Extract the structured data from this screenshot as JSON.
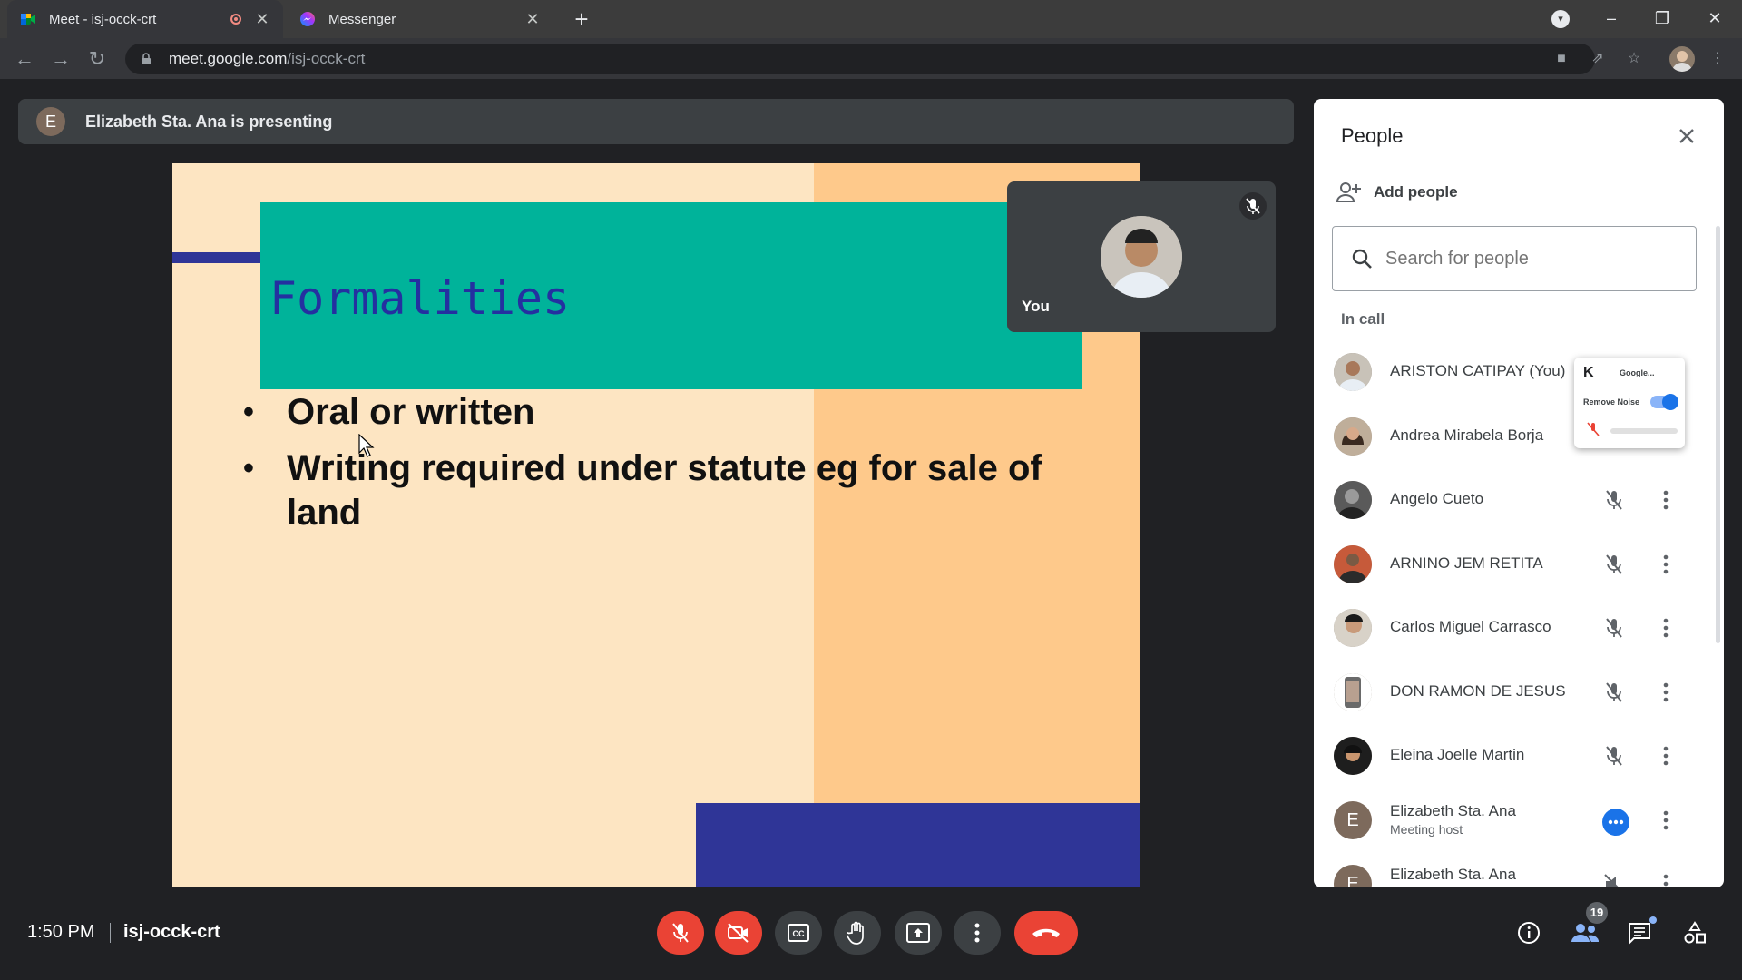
{
  "browser": {
    "tabs": [
      {
        "title": "Meet - isj-occk-crt",
        "active": true
      },
      {
        "title": "Messenger",
        "active": false
      }
    ],
    "url_host": "meet.google.com",
    "url_path": "/isj-occk-crt"
  },
  "meet": {
    "presenting_banner": "Elizabeth Sta. Ana is presenting",
    "presenter_initial": "E",
    "self_tile_label": "You",
    "slide": {
      "title": "Formalities",
      "bullets": [
        "Oral or written",
        "Writing required under statute eg for sale of land"
      ]
    },
    "time": "1:50 PM",
    "meeting_code": "isj-occk-crt",
    "participant_count": "19"
  },
  "people_panel": {
    "title": "People",
    "add_people": "Add people",
    "search_placeholder": "Search for people",
    "section": "In call",
    "participants": [
      {
        "name": "ARISTON CATIPAY (You)",
        "subtitle": "",
        "avatar": "photo"
      },
      {
        "name": "Andrea Mirabela Borja",
        "subtitle": "",
        "avatar": "photo"
      },
      {
        "name": "Angelo Cueto",
        "subtitle": "",
        "avatar": "photo"
      },
      {
        "name": "ARNINO JEM RETITA",
        "subtitle": "",
        "avatar": "photo"
      },
      {
        "name": "Carlos Miguel Carrasco",
        "subtitle": "",
        "avatar": "photo"
      },
      {
        "name": "DON RAMON DE JESUS",
        "subtitle": "",
        "avatar": "photo"
      },
      {
        "name": "Eleina Joelle Martin",
        "subtitle": "",
        "avatar": "photo"
      },
      {
        "name": "Elizabeth Sta. Ana",
        "subtitle": "Meeting host",
        "avatar": "E"
      },
      {
        "name": "Elizabeth Sta. Ana",
        "subtitle": "",
        "avatar": "E"
      }
    ]
  },
  "extension_popup": {
    "logo": "K",
    "source": "Google...",
    "setting": "Remove Noise",
    "enabled": true
  },
  "colors": {
    "end_call": "#ea4335",
    "accent": "#1a73e8",
    "slide_teal": "#00b39a",
    "slide_navy": "#2f3597"
  }
}
